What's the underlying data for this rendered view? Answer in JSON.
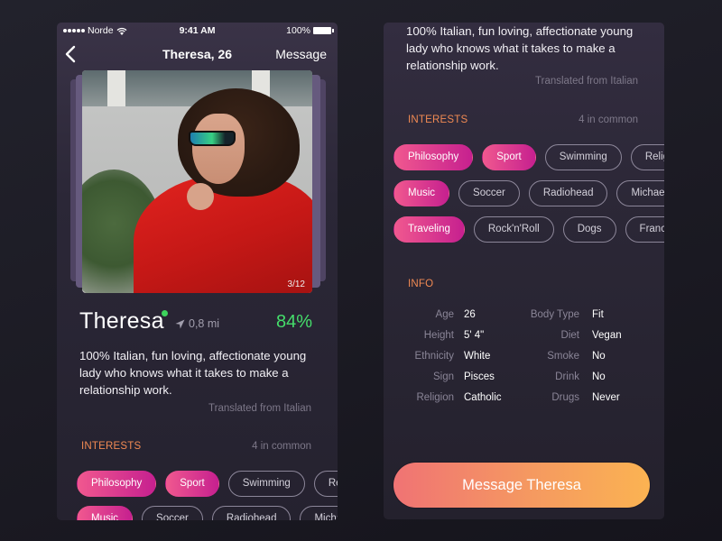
{
  "status_bar": {
    "carrier": "Norde",
    "time": "9:41 AM",
    "battery": "100%"
  },
  "nav": {
    "back_icon": "chevron-left-icon",
    "title": "Theresa, 26",
    "action": "Message"
  },
  "photo": {
    "counter": "3/12"
  },
  "profile": {
    "name": "Theresa",
    "online_status_color": "#3dd35c",
    "location_icon": "location-arrow-icon",
    "distance": "0,8 mi",
    "match": "84%",
    "match_color": "#45de6b",
    "bio": "100% Italian, fun loving, affectionate young lady who knows what it takes to make a relationship work.",
    "translation_note": "Translated from Italian"
  },
  "interests": {
    "label": "INTERESTS",
    "common": "4 in common",
    "rows": [
      [
        {
          "label": "Philosophy",
          "active": true
        },
        {
          "label": "Sport",
          "active": true
        },
        {
          "label": "Swimming",
          "active": false
        },
        {
          "label": "Religion",
          "active": false
        }
      ],
      [
        {
          "label": "Music",
          "active": true
        },
        {
          "label": "Soccer",
          "active": false
        },
        {
          "label": "Radiohead",
          "active": false
        },
        {
          "label": "Michael B",
          "active": false
        }
      ],
      [
        {
          "label": "Traveling",
          "active": true
        },
        {
          "label": "Rock'n'Roll",
          "active": false
        },
        {
          "label": "Dogs",
          "active": false
        },
        {
          "label": "France",
          "active": false
        }
      ]
    ]
  },
  "info": {
    "label": "INFO",
    "rows": [
      {
        "k1": "Age",
        "v1": "26",
        "k2": "Body Type",
        "v2": "Fit"
      },
      {
        "k1": "Height",
        "v1": "5' 4\"",
        "k2": "Diet",
        "v2": "Vegan"
      },
      {
        "k1": "Ethnicity",
        "v1": "White",
        "k2": "Smoke",
        "v2": "No"
      },
      {
        "k1": "Sign",
        "v1": "Pisces",
        "k2": "Drink",
        "v2": "No"
      },
      {
        "k1": "Religion",
        "v1": "Catholic",
        "k2": "Drugs",
        "v2": "Never"
      }
    ]
  },
  "cta": {
    "label": "Message Theresa"
  },
  "colors": {
    "accent_orange": "#f18a53",
    "chip_gradient_start": "#f0588f",
    "chip_gradient_end": "#c6208f",
    "cta_gradient_start": "#f07374",
    "cta_gradient_end": "#fbb352"
  }
}
